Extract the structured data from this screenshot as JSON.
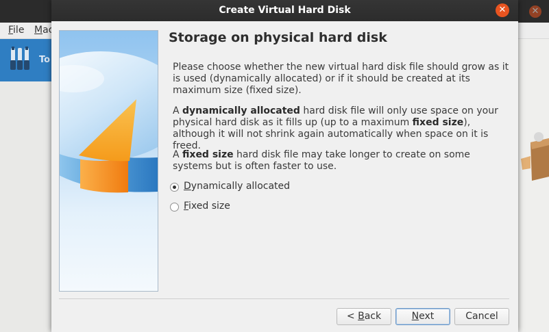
{
  "background_window": {
    "menu": [
      {
        "mnemonic": "F",
        "rest": "ile"
      },
      {
        "mnemonic": "M",
        "rest": "ac"
      }
    ],
    "tools_label": "To"
  },
  "dialog": {
    "title": "Create Virtual Hard Disk",
    "heading": "Storage on physical hard disk",
    "paragraph1": "Please choose whether the new virtual hard disk file should grow as it is used (dynamically allocated) or if it should be created at its maximum size (fixed size).",
    "paragraph2": {
      "t1": "A ",
      "b1": "dynamically allocated",
      "t2": " hard disk file will only use space on your physical hard disk as it fills up (up to a maximum ",
      "b2": "fixed size",
      "t3": "), although it will not shrink again automatically when space on it is freed."
    },
    "paragraph3": {
      "t1": "A ",
      "b1": "fixed size",
      "t2": " hard disk file may take longer to create on some systems but is often faster to use."
    },
    "options": [
      {
        "mnemonic": "D",
        "rest": "ynamically allocated",
        "selected": true
      },
      {
        "mnemonic": "F",
        "rest": "ixed size",
        "selected": false
      }
    ],
    "buttons": {
      "back": {
        "prefix": "< ",
        "mnemonic": "B",
        "rest": "ack"
      },
      "next": {
        "mnemonic": "N",
        "rest": "ext"
      },
      "cancel": {
        "label": "Cancel"
      }
    }
  },
  "colors": {
    "accent_close": "#e95420",
    "titlebar": "#2c2c2c",
    "dialog_bg": "#f0f0f0",
    "tools_blue": "#2f7ec2"
  },
  "icons": [
    "close-icon",
    "tools-icon",
    "hard-disk-illustration",
    "toolbox-icon"
  ]
}
